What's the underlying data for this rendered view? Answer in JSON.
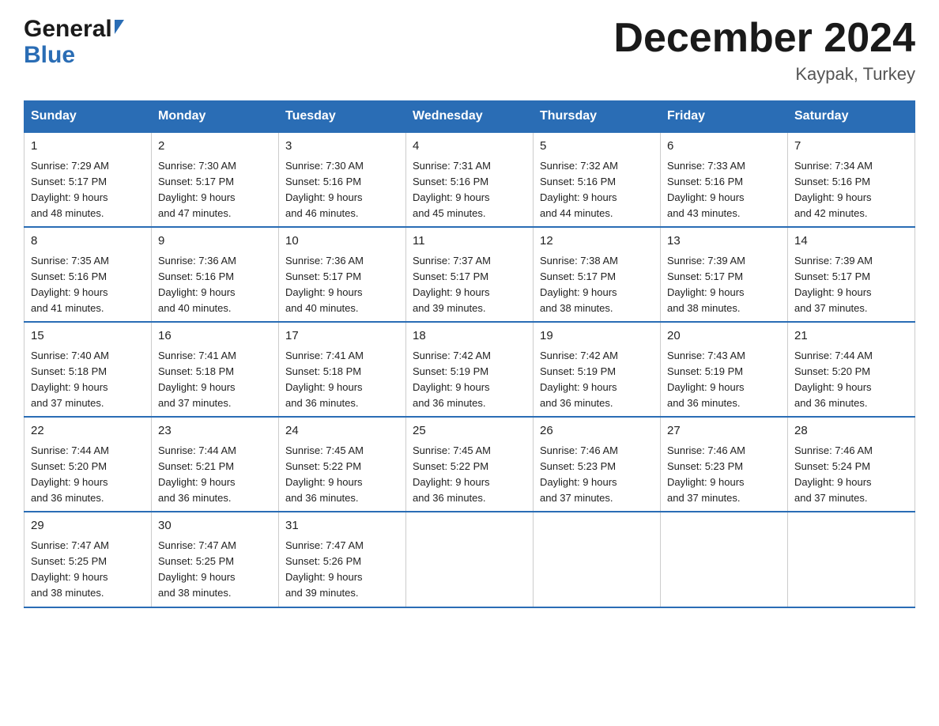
{
  "header": {
    "logo_general": "General",
    "logo_blue": "Blue",
    "month_title": "December 2024",
    "location": "Kaypak, Turkey"
  },
  "weekdays": [
    "Sunday",
    "Monday",
    "Tuesday",
    "Wednesday",
    "Thursday",
    "Friday",
    "Saturday"
  ],
  "weeks": [
    [
      {
        "day": "1",
        "sunrise": "7:29 AM",
        "sunset": "5:17 PM",
        "daylight": "9 hours and 48 minutes."
      },
      {
        "day": "2",
        "sunrise": "7:30 AM",
        "sunset": "5:17 PM",
        "daylight": "9 hours and 47 minutes."
      },
      {
        "day": "3",
        "sunrise": "7:30 AM",
        "sunset": "5:16 PM",
        "daylight": "9 hours and 46 minutes."
      },
      {
        "day": "4",
        "sunrise": "7:31 AM",
        "sunset": "5:16 PM",
        "daylight": "9 hours and 45 minutes."
      },
      {
        "day": "5",
        "sunrise": "7:32 AM",
        "sunset": "5:16 PM",
        "daylight": "9 hours and 44 minutes."
      },
      {
        "day": "6",
        "sunrise": "7:33 AM",
        "sunset": "5:16 PM",
        "daylight": "9 hours and 43 minutes."
      },
      {
        "day": "7",
        "sunrise": "7:34 AM",
        "sunset": "5:16 PM",
        "daylight": "9 hours and 42 minutes."
      }
    ],
    [
      {
        "day": "8",
        "sunrise": "7:35 AM",
        "sunset": "5:16 PM",
        "daylight": "9 hours and 41 minutes."
      },
      {
        "day": "9",
        "sunrise": "7:36 AM",
        "sunset": "5:16 PM",
        "daylight": "9 hours and 40 minutes."
      },
      {
        "day": "10",
        "sunrise": "7:36 AM",
        "sunset": "5:17 PM",
        "daylight": "9 hours and 40 minutes."
      },
      {
        "day": "11",
        "sunrise": "7:37 AM",
        "sunset": "5:17 PM",
        "daylight": "9 hours and 39 minutes."
      },
      {
        "day": "12",
        "sunrise": "7:38 AM",
        "sunset": "5:17 PM",
        "daylight": "9 hours and 38 minutes."
      },
      {
        "day": "13",
        "sunrise": "7:39 AM",
        "sunset": "5:17 PM",
        "daylight": "9 hours and 38 minutes."
      },
      {
        "day": "14",
        "sunrise": "7:39 AM",
        "sunset": "5:17 PM",
        "daylight": "9 hours and 37 minutes."
      }
    ],
    [
      {
        "day": "15",
        "sunrise": "7:40 AM",
        "sunset": "5:18 PM",
        "daylight": "9 hours and 37 minutes."
      },
      {
        "day": "16",
        "sunrise": "7:41 AM",
        "sunset": "5:18 PM",
        "daylight": "9 hours and 37 minutes."
      },
      {
        "day": "17",
        "sunrise": "7:41 AM",
        "sunset": "5:18 PM",
        "daylight": "9 hours and 36 minutes."
      },
      {
        "day": "18",
        "sunrise": "7:42 AM",
        "sunset": "5:19 PM",
        "daylight": "9 hours and 36 minutes."
      },
      {
        "day": "19",
        "sunrise": "7:42 AM",
        "sunset": "5:19 PM",
        "daylight": "9 hours and 36 minutes."
      },
      {
        "day": "20",
        "sunrise": "7:43 AM",
        "sunset": "5:19 PM",
        "daylight": "9 hours and 36 minutes."
      },
      {
        "day": "21",
        "sunrise": "7:44 AM",
        "sunset": "5:20 PM",
        "daylight": "9 hours and 36 minutes."
      }
    ],
    [
      {
        "day": "22",
        "sunrise": "7:44 AM",
        "sunset": "5:20 PM",
        "daylight": "9 hours and 36 minutes."
      },
      {
        "day": "23",
        "sunrise": "7:44 AM",
        "sunset": "5:21 PM",
        "daylight": "9 hours and 36 minutes."
      },
      {
        "day": "24",
        "sunrise": "7:45 AM",
        "sunset": "5:22 PM",
        "daylight": "9 hours and 36 minutes."
      },
      {
        "day": "25",
        "sunrise": "7:45 AM",
        "sunset": "5:22 PM",
        "daylight": "9 hours and 36 minutes."
      },
      {
        "day": "26",
        "sunrise": "7:46 AM",
        "sunset": "5:23 PM",
        "daylight": "9 hours and 37 minutes."
      },
      {
        "day": "27",
        "sunrise": "7:46 AM",
        "sunset": "5:23 PM",
        "daylight": "9 hours and 37 minutes."
      },
      {
        "day": "28",
        "sunrise": "7:46 AM",
        "sunset": "5:24 PM",
        "daylight": "9 hours and 37 minutes."
      }
    ],
    [
      {
        "day": "29",
        "sunrise": "7:47 AM",
        "sunset": "5:25 PM",
        "daylight": "9 hours and 38 minutes."
      },
      {
        "day": "30",
        "sunrise": "7:47 AM",
        "sunset": "5:25 PM",
        "daylight": "9 hours and 38 minutes."
      },
      {
        "day": "31",
        "sunrise": "7:47 AM",
        "sunset": "5:26 PM",
        "daylight": "9 hours and 39 minutes."
      },
      null,
      null,
      null,
      null
    ]
  ],
  "labels": {
    "sunrise": "Sunrise:",
    "sunset": "Sunset:",
    "daylight": "Daylight:"
  }
}
